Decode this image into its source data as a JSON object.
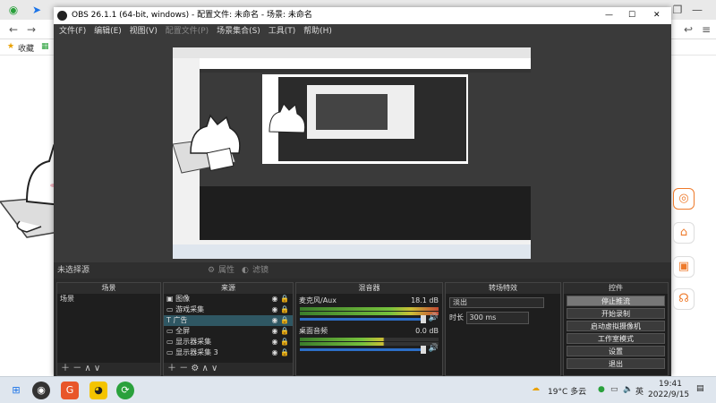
{
  "window": {
    "title": "OBS 26.1.1 (64-bit, windows) - 配置文件: 未命名 - 场景: 未命名"
  },
  "menu": [
    "文件(F)",
    "编辑(E)",
    "视图(V)",
    "配置文件(P)",
    "场景集合(S)",
    "工具(T)",
    "帮助(H)"
  ],
  "scene_bar": {
    "label": "未选择源",
    "properties": "属性",
    "filters": "滤镜"
  },
  "docks": {
    "scenes": {
      "title": "场景",
      "items": [
        "场景"
      ]
    },
    "sources": {
      "title": "来源",
      "items": [
        "图像",
        "游戏采集",
        "广告",
        "全屏",
        "显示器采集",
        "显示器采集 3"
      ],
      "selected_index": 2
    },
    "mixer": {
      "title": "混音器",
      "channels": [
        {
          "name": "麦克风/Aux",
          "db": "18.1 dB"
        },
        {
          "name": "桌面音频",
          "db": "0.0 dB"
        }
      ]
    },
    "transitions": {
      "title": "转场特效",
      "type": "淡出",
      "duration_label": "时长",
      "duration_value": "300 ms"
    },
    "controls": {
      "title": "控件",
      "buttons": [
        "停止推流",
        "开始录制",
        "启动虚拟摄像机",
        "工作室模式",
        "设置",
        "退出"
      ]
    }
  },
  "browser": {
    "bookmark": "收藏",
    "bookmark_icon": "star-icon"
  },
  "taskbar": {
    "weather": "19°C 多云",
    "ime": "英",
    "time": "19:41",
    "date": "2022/9/15"
  }
}
